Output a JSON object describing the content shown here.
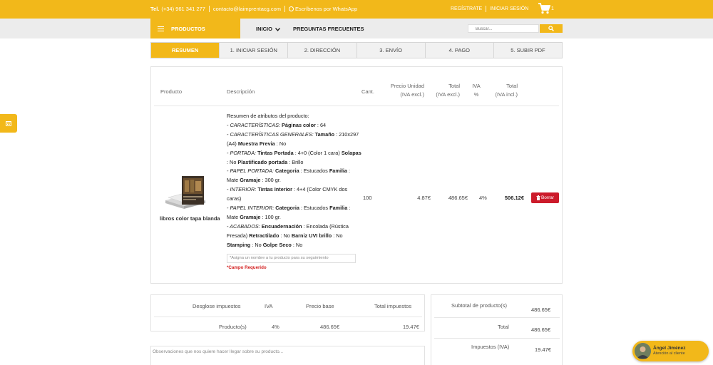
{
  "topbar": {
    "phone_label": "Tel.",
    "phone": "(+34) 961 341 277",
    "email": "contacto@laimprentacg.com",
    "whatsapp": "Escríbenos por WhatsApp",
    "register": "REGÍSTRATE",
    "login": "INICIAR SESIÓN",
    "cart_count": "1"
  },
  "nav": {
    "products": "PRODUCTOS",
    "home": "INICIO",
    "faq": "PREGUNTAS FRECUENTES",
    "search_placeholder": "Buscar..."
  },
  "steps": [
    "RESUMEN",
    "1. INICIAR SESIÓN",
    "2. DIRECCIÓN",
    "3. ENVÍO",
    "4. PAGO",
    "5. SUBIR PDF"
  ],
  "table": {
    "headers": {
      "product": "Producto",
      "description": "Descripción",
      "qty": "Cant.",
      "unit_price_1": "Precio Unidad",
      "unit_price_2": "(IVA excl.)",
      "total_1": "Total",
      "total_2": "(IVA excl.)",
      "iva_1": "IVA",
      "iva_2": "%",
      "total_incl_1": "Total",
      "total_incl_2": "(IVA incl.)"
    },
    "row": {
      "product_name": "libros color tapa blanda",
      "qty": "100",
      "unit_price": "4.87€",
      "total_excl": "486.65€",
      "iva": "4%",
      "total_incl": "506.12€",
      "delete_label": "Borrar"
    },
    "name_placeholder": "*Asigna un nombre a tu producto para su seguimiento",
    "required": "*Campo Requerido"
  },
  "description": {
    "intro": "Resumen de atributos del producto:",
    "l1a": "- CARACTERÍSTICAS: ",
    "l1b": "Páginas color",
    "l1c": " : 64",
    "l2a": "- CARACTERÍSTICAS GENERALES: ",
    "l2b": "Tamaño",
    "l2c": " : 210x297 (A4) ",
    "l2d": "Muestra Previa",
    "l2e": " : No",
    "l3a": "- PORTADA: ",
    "l3b": "Tintas Portada",
    "l3c": " : 4+0 (Color 1 cara) ",
    "l3d": "Solapas",
    "l3e": " : No ",
    "l3f": "Plastificado portada",
    "l3g": " : Brillo",
    "l4a": "- PAPEL PORTADA: ",
    "l4b": "Categoria",
    "l4c": " : Estucados ",
    "l4d": "Familia",
    "l4e": " : Mate ",
    "l4f": "Gramaje",
    "l4g": " : 300 gr.",
    "l5a": "- INTERIOR: ",
    "l5b": "Tintas Interior",
    "l5c": " : 4+4 (Color CMYK dos caras)",
    "l6a": "- PAPEL INTERIOR: ",
    "l6b": "Categoria",
    "l6c": " : Estucados ",
    "l6d": "Familia",
    "l6e": " : Mate ",
    "l6f": "Gramaje",
    "l6g": " : 100 gr.",
    "l7a": "- ACABADOS: ",
    "l7b": "Encuadernación",
    "l7c": " : Encolada (Rústica Fresada) ",
    "l7d": "Retractilado",
    "l7e": " : No ",
    "l7f": "Barniz UVI brillo",
    "l7g": " : No ",
    "l7h": "Stamping",
    "l7i": " : No ",
    "l7j": "Golpe Seco",
    "l7k": " : No"
  },
  "tax": {
    "headers": [
      "Desglose impuestos",
      "IVA",
      "Precio base",
      "Total impuestos"
    ],
    "row": [
      "Producto(s)",
      "4%",
      "486.65€",
      "19.47€"
    ]
  },
  "observations_placeholder": "Observaciones que nos quiere hacer llegar sobre su producto...",
  "totals": {
    "subtotal_label": "Subtotal de producto(s)",
    "subtotal": "486.65€",
    "total_label": "Total",
    "total": "486.65€",
    "taxes_label": "Impuestos (IVA)",
    "taxes": "19.47€"
  },
  "chat": {
    "name": "Ángel Jiménez",
    "role": "Atención al cliente"
  },
  "colors": {
    "accent": "#f2b81a",
    "danger": "#cc1b2b",
    "required": "#d32222"
  }
}
